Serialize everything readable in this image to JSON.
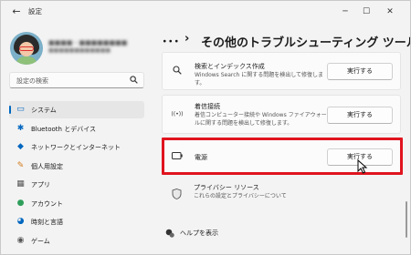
{
  "window": {
    "title": "設定",
    "back": "←",
    "minimize": "─",
    "maximize": "☐",
    "close": "✕"
  },
  "user": {
    "name": "■■■■・■■■■■■■■",
    "email": "■■■■■■■■■■■■"
  },
  "search": {
    "placeholder": "設定の検索",
    "icon": "search-icon"
  },
  "sidebar": {
    "items": [
      {
        "label": "システム",
        "icon": "system-icon",
        "glyph": "▭",
        "color": "#0067c0",
        "selected": true
      },
      {
        "label": "Bluetooth とデバイス",
        "icon": "bluetooth-icon",
        "glyph": "✱",
        "color": "#0067c0",
        "selected": false
      },
      {
        "label": "ネットワークとインターネット",
        "icon": "network-icon",
        "glyph": "◆",
        "color": "#0067c0",
        "selected": false
      },
      {
        "label": "個人用設定",
        "icon": "brush-icon",
        "glyph": "✎",
        "color": "#d07a18",
        "selected": false
      },
      {
        "label": "アプリ",
        "icon": "apps-icon",
        "glyph": "▦",
        "color": "#555555",
        "selected": false
      },
      {
        "label": "アカウント",
        "icon": "account-icon",
        "glyph": "●",
        "color": "#2e9e5b",
        "selected": false
      },
      {
        "label": "時刻と言語",
        "icon": "time-language-icon",
        "glyph": "◕",
        "color": "#0067c0",
        "selected": false
      },
      {
        "label": "ゲーム",
        "icon": "gaming-icon",
        "glyph": "◉",
        "color": "#555555",
        "selected": false
      }
    ]
  },
  "breadcrumb": {
    "dots": "･･･",
    "separator": "›",
    "title": "その他のトラブルシューティング ツール"
  },
  "troubleshooters": [
    {
      "title": "検索とインデックス作成",
      "description": "Windows Search に関する問題を検出して修復します。",
      "icon": "search-icon",
      "glyph": "⚲",
      "button": "実行する"
    },
    {
      "title": "着信接続",
      "description": "着信コンピューター接続や Windows ファイアウォールに関する問題を検出して修復します。",
      "icon": "incoming-connection-icon",
      "glyph": "((•))",
      "button": "実行する"
    },
    {
      "title": "電源",
      "description": "",
      "icon": "battery-icon",
      "glyph": "▭",
      "button": "実行する"
    }
  ],
  "privacy": {
    "title": "プライバシー リソース",
    "description": "これらの設定とプライバシーについて",
    "icon": "shield-icon"
  },
  "help": {
    "label": "ヘルプを表示",
    "icon": "help-icon"
  },
  "colors": {
    "accent": "#0067c0",
    "highlight_border": "#e0141e"
  }
}
